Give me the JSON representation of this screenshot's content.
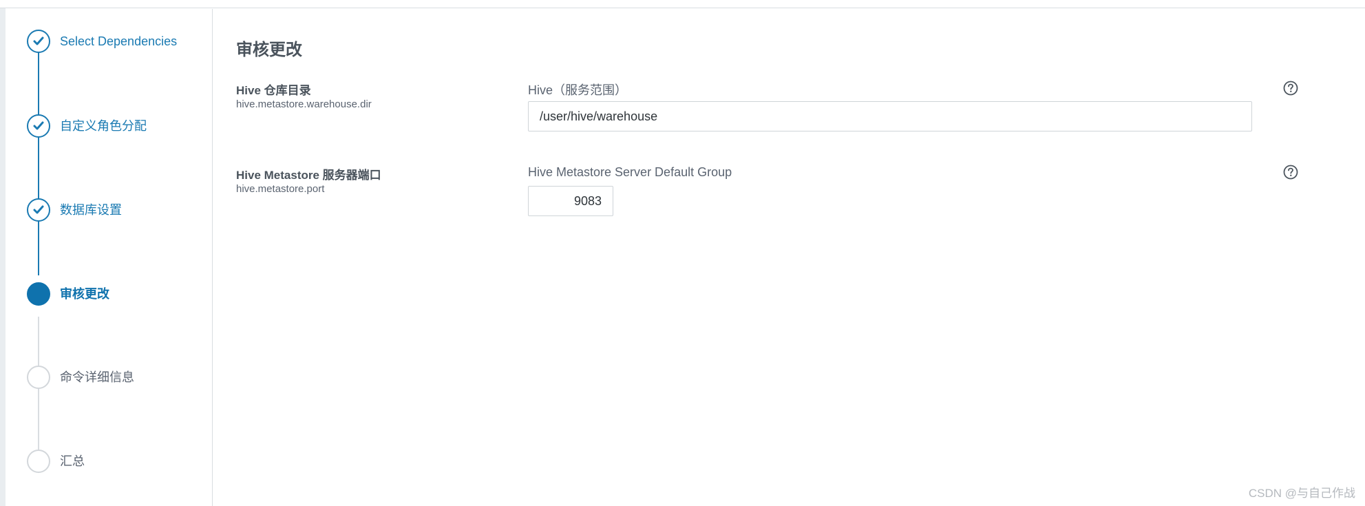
{
  "sidebar": {
    "steps": [
      {
        "label": "Select Dependencies",
        "state": "done"
      },
      {
        "label": "自定义角色分配",
        "state": "done"
      },
      {
        "label": "数据库设置",
        "state": "done"
      },
      {
        "label": "审核更改",
        "state": "current"
      },
      {
        "label": "命令详细信息",
        "state": "pending"
      },
      {
        "label": "汇总",
        "state": "pending"
      }
    ]
  },
  "main": {
    "title": "审核更改",
    "properties": [
      {
        "name": "Hive 仓库目录",
        "key": "hive.metastore.warehouse.dir",
        "scope": "Hive（服务范围）",
        "value": "/user/hive/warehouse",
        "help_icon": "question-circle-icon"
      },
      {
        "name": "Hive Metastore 服务器端口",
        "key": "hive.metastore.port",
        "scope": "Hive Metastore Server Default Group",
        "value": "9083",
        "help_icon": "question-circle-icon"
      }
    ]
  },
  "watermark": "CSDN @与自己作战",
  "colors": {
    "accent": "#1a7ab2",
    "current": "#0f72ad",
    "pending": "#d3d7db",
    "text": "#4a535c"
  }
}
